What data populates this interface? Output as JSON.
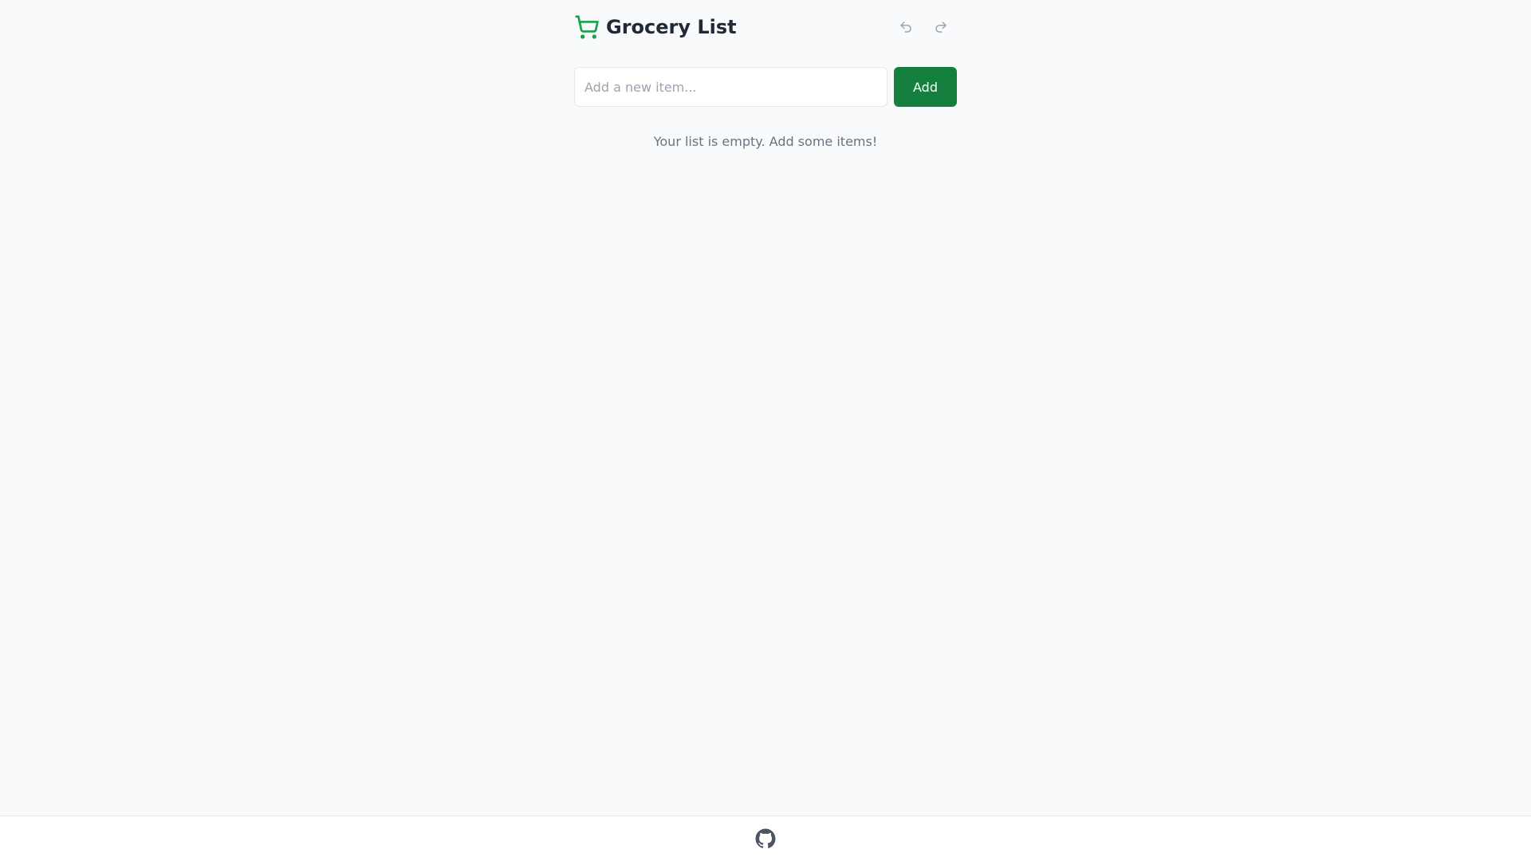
{
  "header": {
    "title": "Grocery List",
    "icon": "shopping-cart-icon",
    "undo_icon": "undo-icon",
    "redo_icon": "redo-icon"
  },
  "add_form": {
    "input_value": "",
    "input_placeholder": "Add a new item...",
    "add_label": "Add"
  },
  "list": {
    "empty_message": "Your list is empty. Add some items!"
  },
  "footer": {
    "icon": "github-icon"
  },
  "colors": {
    "accent": "#16a34a",
    "add_button": "#15803d",
    "background": "#f9fafb",
    "muted_text": "#6b7280"
  }
}
